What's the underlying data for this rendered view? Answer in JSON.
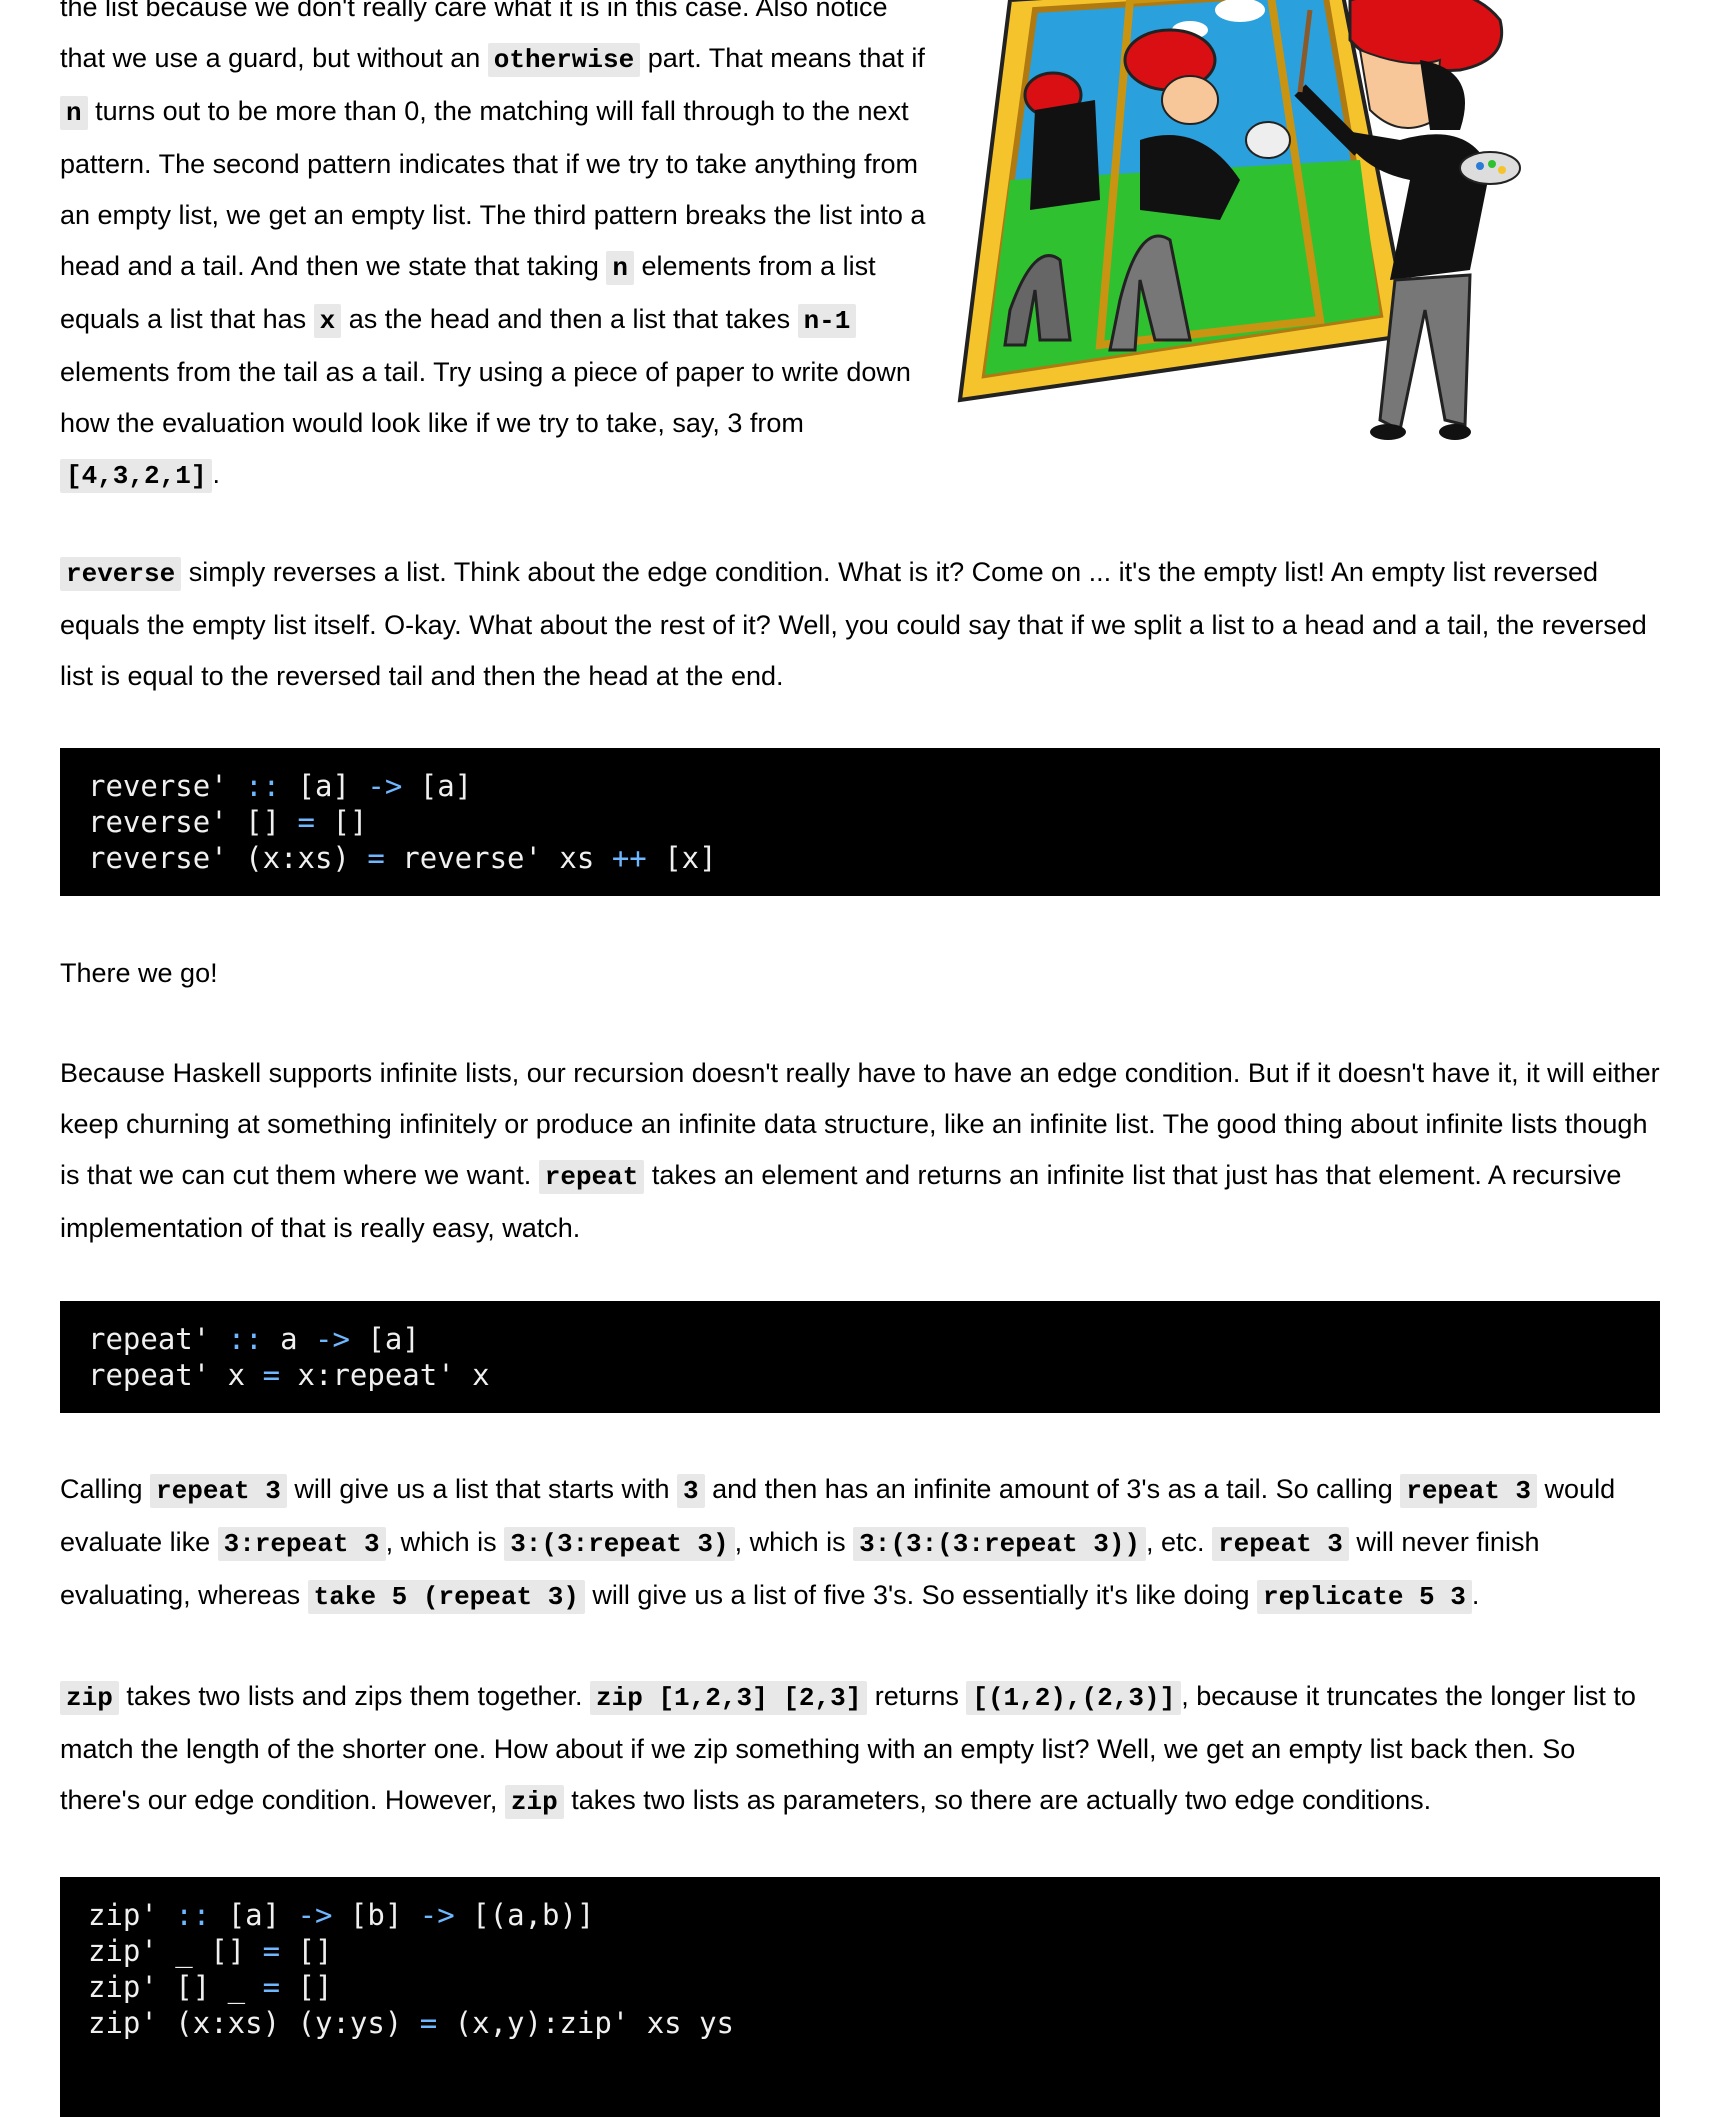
{
  "intro": {
    "t1": "the list because we don't really care what it is in this case. Also notice that we use a guard, but without an ",
    "c1": "otherwise",
    "t2": " part. That means that if ",
    "c2": "n",
    "t3": " turns out to be more than 0, the matching will fall through to the next pattern. The second pattern indicates that if we try to take anything from an empty list, we get an empty list. The third pattern breaks the list into a head and a tail. And then we state that taking ",
    "c3": "n",
    "t4": " elements from a list equals a list that has ",
    "c4": "x",
    "t5": " as the head and then a list that takes ",
    "c5": "n-1",
    "t6": " elements from the tail as a tail. Try using a piece of paper to write down how the evaluation would look like if we try to take, say, 3 from ",
    "c6": "[4,3,2,1]",
    "t7": "."
  },
  "reverse_para": {
    "c1": "reverse",
    "t1": " simply reverses a list. Think about the edge condition. What is it? Come on ... it's the empty list! An empty list reversed equals the empty list itself. O-kay. What about the rest of it? Well, you could say that if we split a list to a head and a tail, the reversed list is equal to the reversed tail and then the head at the end."
  },
  "code_reverse": {
    "l1a": "reverse' ",
    "l1op1": "::",
    "l1b": " [a] ",
    "l1op2": "->",
    "l1c": " [a]",
    "l2a": "reverse' [] ",
    "l2op1": "=",
    "l2b": " []",
    "l3a": "reverse' (x:xs) ",
    "l3op1": "=",
    "l3b": " reverse' xs ",
    "l3op2": "++",
    "l3c": " [x]"
  },
  "therewego": "There we go!",
  "infinite_para": {
    "t1": "Because Haskell supports infinite lists, our recursion doesn't really have to have an edge condition. But if it doesn't have it, it will either keep churning at something infinitely or produce an infinite data structure, like an infinite list. The good thing about infinite lists though is that we can cut them where we want. ",
    "c1": "repeat",
    "t2": " takes an element and returns an infinite list that just has that element. A recursive implementation of that is really easy, watch."
  },
  "code_repeat": {
    "l1a": "repeat' ",
    "l1op1": "::",
    "l1b": " a ",
    "l1op2": "->",
    "l1c": " [a]",
    "l2a": "repeat' x ",
    "l2op1": "=",
    "l2b": " x:repeat' x"
  },
  "calling_para": {
    "t1": "Calling ",
    "c1": "repeat 3",
    "t2": " will give us a list that starts with ",
    "c2": "3",
    "t3": " and then has an infinite amount of 3's as a tail. So calling ",
    "c3": "repeat 3",
    "t4": " would evaluate like ",
    "c4": "3:repeat 3",
    "t5": ", which is ",
    "c5": "3:(3:repeat 3)",
    "t6": ", which is ",
    "c6": "3:(3:(3:repeat 3))",
    "t7": ", etc. ",
    "c7": "repeat 3",
    "t8": " will never finish evaluating, whereas ",
    "c8": "take 5 (repeat 3)",
    "t9": " will give us a list of five 3's. So essentially it's like doing ",
    "c9": "replicate 5 3",
    "t10": "."
  },
  "zip_para": {
    "c1": "zip",
    "t1": " takes two lists and zips them together. ",
    "c2": "zip [1,2,3] [2,3]",
    "t2": " returns ",
    "c3": "[(1,2),(2,3)]",
    "t3": ", because it truncates the longer list to match the length of the shorter one. How about if we zip something with an empty list? Well, we get an empty list back then. So there's our edge condition. However, ",
    "c4": "zip",
    "t4": " takes two lists as parameters, so there are actually two edge conditions."
  },
  "code_zip": {
    "l1a": "zip' ",
    "l1op1": "::",
    "l1b": " [a] ",
    "l1op2": "->",
    "l1c": " [b] ",
    "l1op3": "->",
    "l1d": " [(a,b)]",
    "l2a": "zip' _ [] ",
    "l2op1": "=",
    "l2b": " []",
    "l3a": "zip' [] _ ",
    "l3op1": "=",
    "l3b": " []",
    "l4a": "zip' (x:xs) (y:ys) ",
    "l4op1": "=",
    "l4b": " (x,y):zip' xs ys"
  },
  "illustration": {
    "icon": "painter-painting-itself-illustration",
    "colors": {
      "beret": "#d90f14",
      "frame": "#f5c42c",
      "sky": "#2aa0dd",
      "grass": "#2fc12f"
    }
  }
}
